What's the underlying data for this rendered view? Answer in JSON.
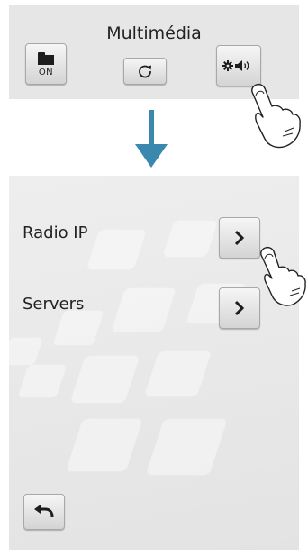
{
  "top_panel": {
    "title": "Multimédia",
    "folder_button_label": "ON"
  },
  "screen2": {
    "items": [
      {
        "label": "Radio IP"
      },
      {
        "label": "Servers"
      }
    ]
  },
  "icons": {
    "folder": "folder-icon",
    "refresh": "refresh-icon",
    "settings_speaker": "gear-speaker-icon",
    "arrow_down": "arrow-down-icon",
    "chevron_right": "chevron-right-icon",
    "back": "back-arrow-icon",
    "hand": "pointing-hand-icon"
  },
  "colors": {
    "arrow": "#3a88ad",
    "panel": "#e6e6e6",
    "text": "#222222"
  }
}
